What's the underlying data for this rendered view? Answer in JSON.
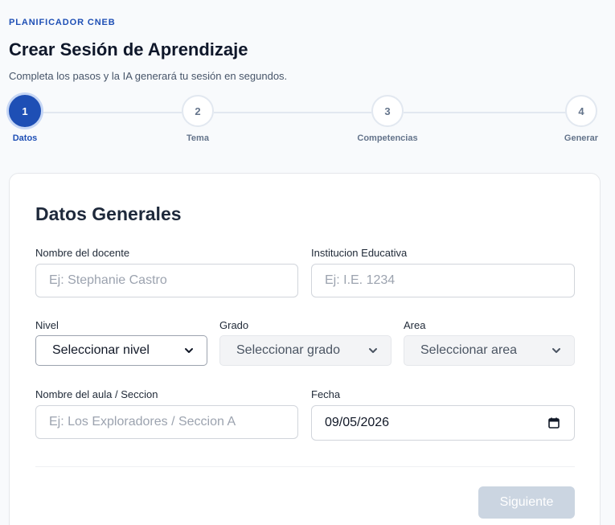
{
  "header": {
    "eyebrow": "PLANIFICADOR CNEB",
    "title": "Crear Sesión de Aprendizaje",
    "subtitle": "Completa los pasos y la IA generará tu sesión en segundos."
  },
  "stepper": {
    "steps": [
      {
        "number": "1",
        "label": "Datos",
        "active": true
      },
      {
        "number": "2",
        "label": "Tema",
        "active": false
      },
      {
        "number": "3",
        "label": "Competencias",
        "active": false
      },
      {
        "number": "4",
        "label": "Generar",
        "active": false
      }
    ]
  },
  "form": {
    "title": "Datos Generales",
    "docente": {
      "label": "Nombre del docente",
      "placeholder": "Ej: Stephanie Castro",
      "value": ""
    },
    "institucion": {
      "label": "Institucion Educativa",
      "placeholder": "Ej: I.E. 1234",
      "value": ""
    },
    "nivel": {
      "label": "Nivel",
      "selected": "Seleccionar nivel"
    },
    "grado": {
      "label": "Grado",
      "selected": "Seleccionar grado"
    },
    "area": {
      "label": "Area",
      "selected": "Seleccionar area"
    },
    "aula": {
      "label": "Nombre del aula / Seccion",
      "placeholder": "Ej: Los Exploradores / Seccion A",
      "value": ""
    },
    "fecha": {
      "label": "Fecha",
      "value": "09/05/2026"
    },
    "next_label": "Siguiente"
  },
  "colors": {
    "accent": "#1e4fb5",
    "disabled_button": "#cbd5e1"
  }
}
